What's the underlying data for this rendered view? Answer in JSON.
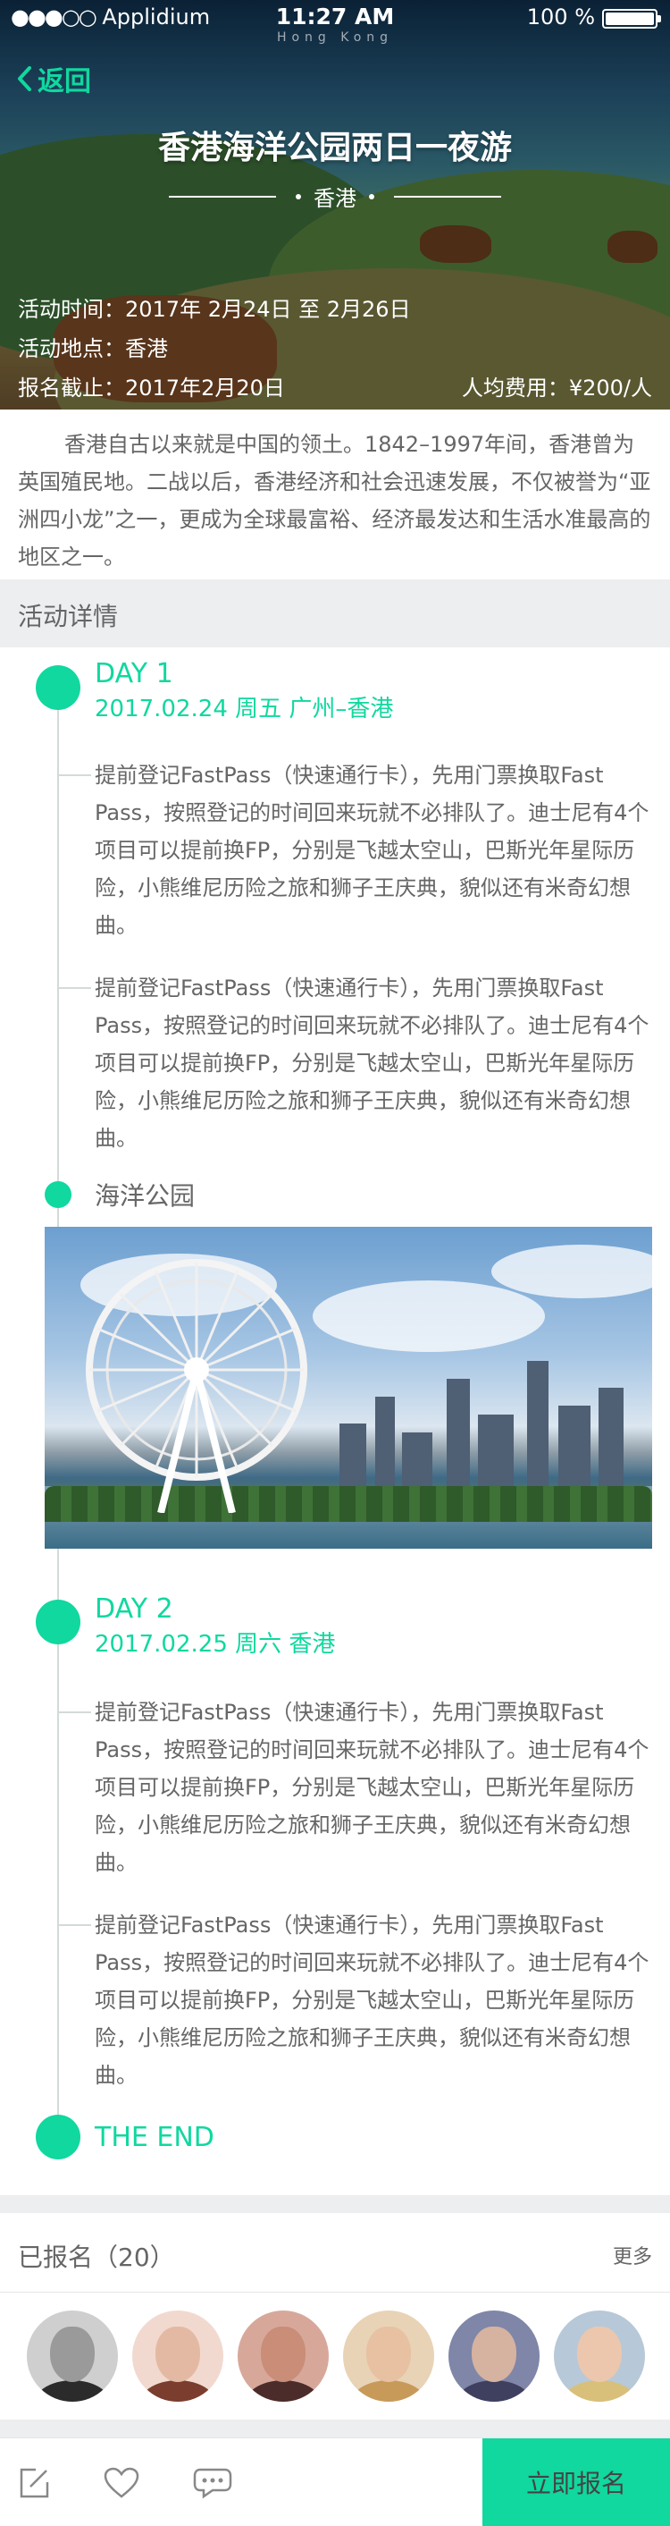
{
  "status_bar": {
    "carrier": "Applidium",
    "time": "11:27 AM",
    "battery": "100 %"
  },
  "hero": {
    "sub_label": "Hong Kong",
    "back_label": "返回",
    "title": "香港海洋公园两日一夜游",
    "city": "香港",
    "time_label": "活动时间：2017年 2月24日 至 2月26日",
    "place_label": "活动地点：香港",
    "deadline_label": "报名截止：2017年2月20日",
    "fee_label": "人均费用：¥200/人"
  },
  "intro": "香港自古以来就是中国的领土。1842–1997年间，香港曾为英国殖民地。二战以后，香港经济和社会迅速发展，不仅被誉为“亚洲四小龙”之一，更成为全球最富裕、经济最发达和生活水准最高的地区之一。",
  "section_title": "活动详情",
  "timeline": {
    "day1": {
      "label": "DAY 1",
      "date": "2017.02.24  周五  广州–香港",
      "para1": "提前登记FastPass（快速通行卡），先用门票换取Fast Pass，按照登记的时间回来玩就不必排队了。迪士尼有4个项目可以提前换FP，分别是飞越太空山，巴斯光年星际历险，小熊维尼历险之旅和狮子王庆典，貌似还有米奇幻想曲。",
      "para2": "提前登记FastPass（快速通行卡），先用门票换取Fast Pass，按照登记的时间回来玩就不必排队了。迪士尼有4个项目可以提前换FP，分别是飞越太空山，巴斯光年星际历险，小熊维尼历险之旅和狮子王庆典，貌似还有米奇幻想曲。",
      "spot": "海洋公园"
    },
    "day2": {
      "label": "DAY 2",
      "date": "2017.02.25  周六  香港",
      "para1": "提前登记FastPass（快速通行卡），先用门票换取Fast Pass，按照登记的时间回来玩就不必排队了。迪士尼有4个项目可以提前换FP，分别是飞越太空山，巴斯光年星际历险，小熊维尼历险之旅和狮子王庆典，貌似还有米奇幻想曲。",
      "para2": "提前登记FastPass（快速通行卡），先用门票换取Fast Pass，按照登记的时间回来玩就不必排队了。迪士尼有4个项目可以提前换FP，分别是飞越太空山，巴斯光年星际历险，小熊维尼历险之旅和狮子王庆典，貌似还有米奇幻想曲。"
    },
    "end_label": "THE END"
  },
  "signup": {
    "title": "已报名（20）",
    "more": "更多",
    "avatars": [
      "avatar-1",
      "avatar-2",
      "avatar-3",
      "avatar-4",
      "avatar-5",
      "avatar-6"
    ]
  },
  "bottom_bar": {
    "icons": [
      "edit-icon",
      "heart-icon",
      "chat-icon"
    ],
    "join_label": "立即报名"
  },
  "colors": {
    "accent": "#10D89F",
    "text": "#666666",
    "section_bg": "#eceef0",
    "timeline_line": "#D3DBD9",
    "button_text": "#444444"
  }
}
